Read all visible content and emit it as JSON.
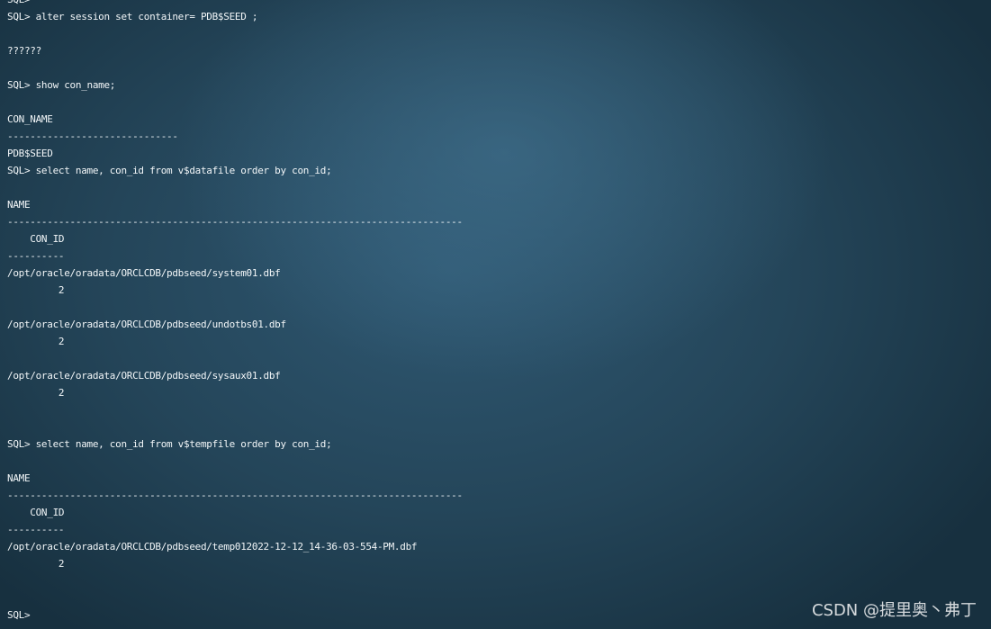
{
  "terminal": {
    "lines": [
      "SQL>",
      "SQL> alter session set container= PDB$SEED ;",
      "",
      "??????",
      "",
      "SQL> show con_name;",
      "",
      "CON_NAME",
      "------------------------------",
      "PDB$SEED",
      "SQL> select name, con_id from v$datafile order by con_id;",
      "",
      "NAME",
      "--------------------------------------------------------------------------------",
      "    CON_ID",
      "----------",
      "/opt/oracle/oradata/ORCLCDB/pdbseed/system01.dbf",
      "         2",
      "",
      "/opt/oracle/oradata/ORCLCDB/pdbseed/undotbs01.dbf",
      "         2",
      "",
      "/opt/oracle/oradata/ORCLCDB/pdbseed/sysaux01.dbf",
      "         2",
      "",
      "",
      "SQL> select name, con_id from v$tempfile order by con_id;",
      "",
      "NAME",
      "--------------------------------------------------------------------------------",
      "    CON_ID",
      "----------",
      "/opt/oracle/oradata/ORCLCDB/pdbseed/temp012022-12-12_14-36-03-554-PM.dbf",
      "         2",
      "",
      "",
      "SQL>"
    ]
  },
  "watermark": {
    "text": "CSDN @提里奥丶弗丁"
  }
}
